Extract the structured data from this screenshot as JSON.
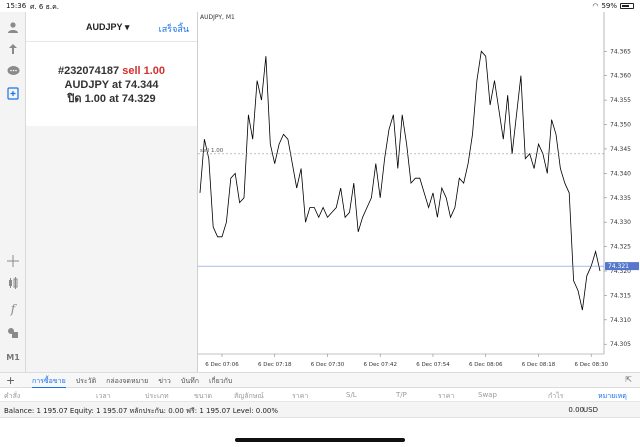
{
  "status_bar": {
    "time": "15:36",
    "date": "ศ. 6 ธ.ค.",
    "wifi": "wifi",
    "battery": "59%"
  },
  "toolbar": {
    "icons": [
      "account-icon",
      "trade-icon",
      "chat-icon",
      "new-order-icon",
      "crosshair-icon",
      "indicators-icon",
      "function-icon",
      "objects-icon",
      "timeframe-icon"
    ],
    "timeframe": "M1"
  },
  "order_panel": {
    "symbol": "AUDJPY",
    "symbol_caret": "▾",
    "done": "เสร็จสิ้น",
    "ticket": "#232074187",
    "action": "sell 1.00",
    "line2_prefix": "AUDJPY at",
    "open_price": "74.344",
    "line3_prefix": "ปิด 1.00 at",
    "close_price": "74.329"
  },
  "chart": {
    "title": "AUDJPY, M1",
    "order_line_label": "sell 1.00",
    "current_price": "74.321"
  },
  "chart_data": {
    "type": "line",
    "title": "AUDJPY, M1",
    "ylim": [
      74.303,
      74.371
    ],
    "yticks": [
      "74.365",
      "74.360",
      "74.355",
      "74.350",
      "74.345",
      "74.340",
      "74.335",
      "74.330",
      "74.325",
      "74.320",
      "74.315",
      "74.310",
      "74.305"
    ],
    "xticks": [
      "6 Dec 07:06",
      "6 Dec 07:18",
      "6 Dec 07:30",
      "6 Dec 07:42",
      "6 Dec 07:54",
      "6 Dec 08:06",
      "6 Dec 08:18",
      "6 Dec 08:30"
    ],
    "x": [
      "07:01",
      "07:02",
      "07:03",
      "07:04",
      "07:05",
      "07:06",
      "07:07",
      "07:08",
      "07:09",
      "07:10",
      "07:11",
      "07:12",
      "07:13",
      "07:14",
      "07:15",
      "07:16",
      "07:17",
      "07:18",
      "07:19",
      "07:20",
      "07:21",
      "07:22",
      "07:23",
      "07:24",
      "07:25",
      "07:26",
      "07:27",
      "07:28",
      "07:29",
      "07:30",
      "07:31",
      "07:32",
      "07:33",
      "07:34",
      "07:35",
      "07:36",
      "07:37",
      "07:38",
      "07:39",
      "07:40",
      "07:41",
      "07:42",
      "07:43",
      "07:44",
      "07:45",
      "07:46",
      "07:47",
      "07:48",
      "07:49",
      "07:50",
      "07:51",
      "07:52",
      "07:53",
      "07:54",
      "07:55",
      "07:56",
      "07:57",
      "07:58",
      "07:59",
      "08:00",
      "08:01",
      "08:02",
      "08:03",
      "08:04",
      "08:05",
      "08:06",
      "08:07",
      "08:08",
      "08:09",
      "08:10",
      "08:11",
      "08:12",
      "08:13",
      "08:14",
      "08:15",
      "08:16",
      "08:17",
      "08:18",
      "08:19",
      "08:20",
      "08:21",
      "08:22",
      "08:23",
      "08:24",
      "08:25",
      "08:26",
      "08:27",
      "08:28",
      "08:29",
      "08:30",
      "08:31",
      "08:32"
    ],
    "series": [
      {
        "values": [
          74.336,
          74.347,
          74.343,
          74.329,
          74.327,
          74.327,
          74.33,
          74.339,
          74.34,
          74.334,
          74.335,
          74.352,
          74.347,
          74.359,
          74.355,
          74.364,
          74.346,
          74.342,
          74.346,
          74.348,
          74.347,
          74.342,
          74.337,
          74.341,
          74.33,
          74.333,
          74.333,
          74.331,
          74.333,
          74.331,
          74.332,
          74.333,
          74.337,
          74.331,
          74.332,
          74.338,
          74.328,
          74.331,
          74.333,
          74.335,
          74.342,
          74.335,
          74.343,
          74.349,
          74.352,
          74.341,
          74.352,
          74.346,
          74.338,
          74.339,
          74.339,
          74.336,
          74.333,
          74.336,
          74.331,
          74.337,
          74.335,
          74.331,
          74.333,
          74.339,
          74.338,
          74.342,
          74.348,
          74.359,
          74.365,
          74.364,
          74.354,
          74.359,
          74.353,
          74.347,
          74.356,
          74.344,
          74.352,
          74.36,
          74.343,
          74.344,
          74.341,
          74.346,
          74.344,
          74.34,
          74.351,
          74.348,
          74.341,
          74.338,
          74.336,
          74.318,
          74.316,
          74.312,
          74.319,
          74.321,
          74.324,
          74.32
        ],
        "color": "#000000"
      }
    ],
    "annotations": [
      {
        "text": "sell 1.00",
        "y": 74.344
      },
      {
        "text": "74.321",
        "y": 74.321
      }
    ],
    "grid": false
  },
  "bottom_tabs": {
    "add": "+",
    "tabs": [
      "การซื้อขาย",
      "ประวัติ",
      "กล่องจดหมาย",
      "ข่าว",
      "บันทึก",
      "เกี่ยวกับ"
    ],
    "active": 0,
    "expand": "⇱"
  },
  "columns": [
    "คำสั่ง",
    "เวลา",
    "ประเภท",
    "ขนาด",
    "สัญลักษณ์",
    "ราคา",
    "S/L",
    "T/P",
    "ราคา",
    "Swap",
    "กำไร",
    "หมายเหตุ"
  ],
  "balance_row": {
    "text": "Balance: 1 195.07 Equity: 1 195.07 หลักประกัน: 0.00 ฟรี: 1 195.07 Level: 0.00%",
    "profit": "0.00",
    "currency": "USD"
  },
  "colors": {
    "accent": "#1a73e8",
    "sell": "#d32f2f",
    "price_line": "#5577cc"
  }
}
